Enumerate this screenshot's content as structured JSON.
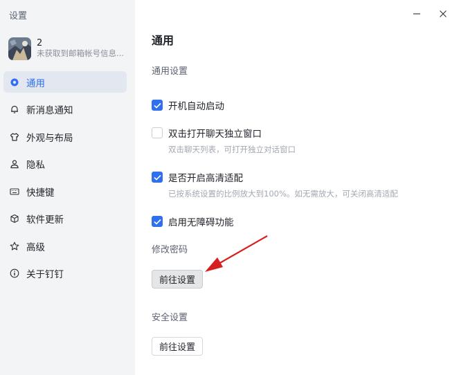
{
  "app": {
    "title": "设置"
  },
  "profile": {
    "name": "2",
    "subtitle": "未获取到邮箱帐号信息..."
  },
  "sidebar": {
    "items": [
      {
        "label": "通用",
        "icon": "general-icon",
        "active": true
      },
      {
        "label": "新消息通知",
        "icon": "bell-icon"
      },
      {
        "label": "外观与布局",
        "icon": "shirt-icon"
      },
      {
        "label": "隐私",
        "icon": "person-icon"
      },
      {
        "label": "快捷键",
        "icon": "keyboard-icon"
      },
      {
        "label": "软件更新",
        "icon": "cube-icon"
      },
      {
        "label": "高级",
        "icon": "star-icon"
      },
      {
        "label": "关于钉钉",
        "icon": "info-icon"
      }
    ]
  },
  "main": {
    "title": "通用",
    "general_section": "通用设置",
    "options": [
      {
        "label": "开机自动启动",
        "checked": true
      },
      {
        "label": "双击打开聊天独立窗口",
        "checked": false,
        "hint": "双击聊天列表，可打开独立对话窗口"
      },
      {
        "label": "是否开启高清适配",
        "checked": true,
        "hint": "已按系统设置的比例放大到100%。如无需放大，可关闭高清适配"
      },
      {
        "label": "启用无障碍功能",
        "checked": true
      }
    ],
    "password_section": "修改密码",
    "password_button": "前往设置",
    "security_section": "安全设置",
    "security_button": "前往设置"
  },
  "colors": {
    "accent": "#2f6ff0",
    "sidebar_bg": "#f3f4f6",
    "active_bg": "#e2e7f0",
    "arrow": "#d62020"
  }
}
